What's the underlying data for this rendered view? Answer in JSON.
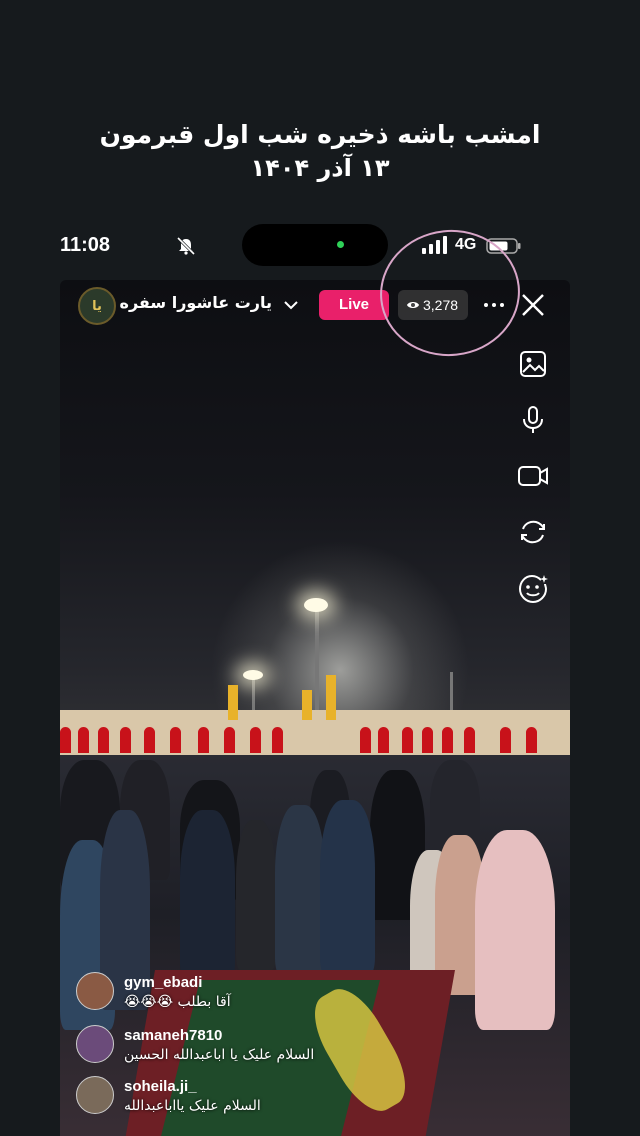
{
  "caption": {
    "line1": "امشب باشه ذخیره شب اول قبرمون",
    "line2": "۱۳ آذر ۱۴۰۴"
  },
  "status_bar": {
    "time": "11:08",
    "network": "4G",
    "icons": [
      "bell-slash-icon",
      "signal-icon",
      "battery-icon"
    ]
  },
  "live_header": {
    "account_name": "یارت عاشورا سفره ·",
    "avatar_text": "یا",
    "live_label": "Live",
    "viewer_count": "3,278",
    "icons": [
      "chevron-down-icon",
      "eye-icon",
      "more-icon",
      "close-icon"
    ]
  },
  "side_controls": [
    "image-icon",
    "microphone-icon",
    "video-camera-icon",
    "flip-camera-icon",
    "face-effects-icon"
  ],
  "comments": [
    {
      "username": "gym_ebadi",
      "text": "آقا بطلب 😭😭😭",
      "avatar_color": "#8a5a44"
    },
    {
      "username": "samaneh7810",
      "text": "السلام علیک یا اباعبدالله الحسین",
      "avatar_color": "#6b4b7a"
    },
    {
      "username": "soheila.ji_",
      "text": "السلام علیک یااباعبدالله",
      "avatar_color": "#7a6a5a"
    }
  ],
  "colors": {
    "background": "#161a1d",
    "live_badge": "#e9206a",
    "annotation_circle": "#d8a6c8"
  }
}
